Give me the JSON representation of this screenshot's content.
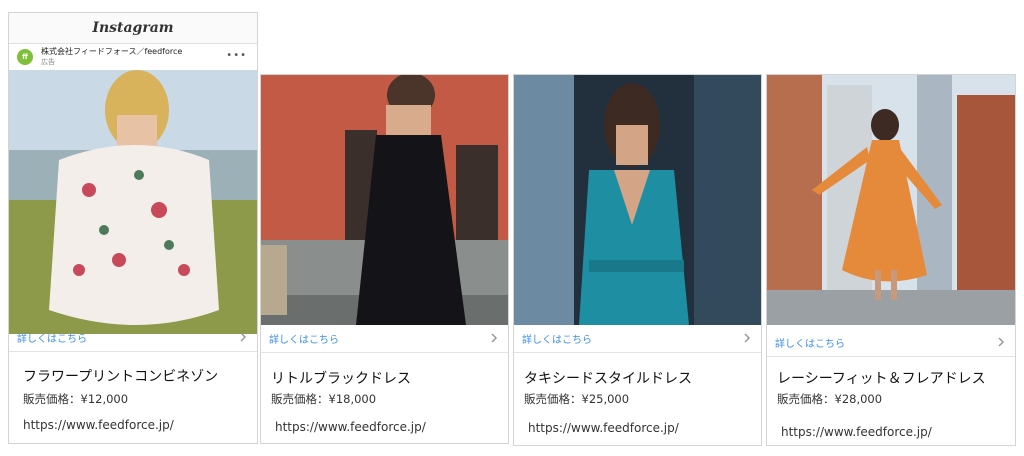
{
  "instagram": {
    "brand": "Instagram",
    "account_name": "株式会社フィードフォース／feedforce",
    "account_sub": "広告",
    "more_menu": "•••"
  },
  "cards": [
    {
      "more_label": "詳しくはこちら",
      "title": "フラワープリントコンビネゾン",
      "price": "販売価格：¥12,000",
      "url": "https://www.feedforce.jp/"
    },
    {
      "more_label": "詳しくはこちら",
      "title": "リトルブラックドレス",
      "price": "販売価格：¥18,000",
      "url": "https://www.feedforce.jp/"
    },
    {
      "more_label": "詳しくはこちら",
      "title": "タキシードスタイルドレス",
      "price": "販売価格：¥25,000",
      "url": "https://www.feedforce.jp/"
    },
    {
      "more_label": "詳しくはこちら",
      "title": "レーシーフィット＆フレアドレス",
      "price": "販売価格：¥28,000",
      "url": "https://www.feedforce.jp/"
    }
  ],
  "colors": {
    "link_blue": "#3b8fe8",
    "border": "#d4d4d4"
  }
}
